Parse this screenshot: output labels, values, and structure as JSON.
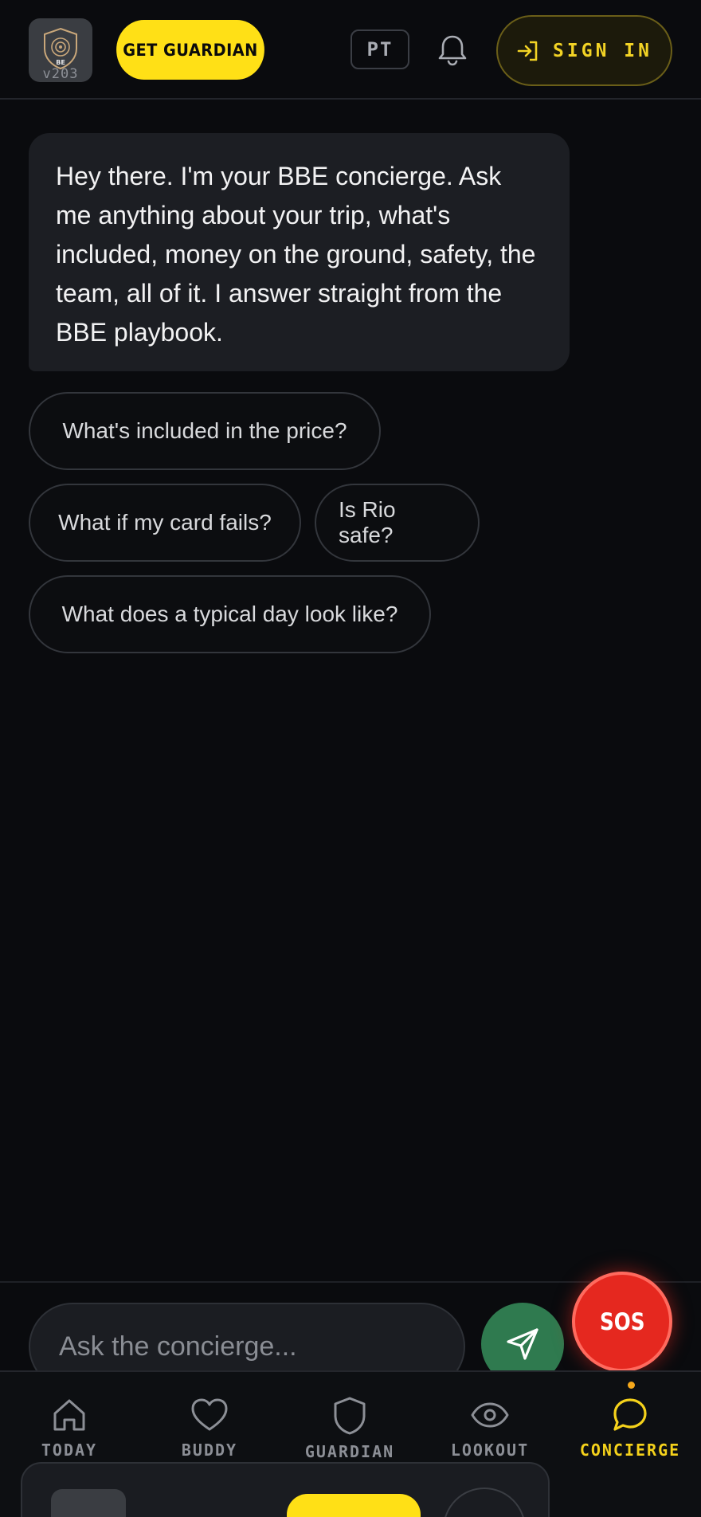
{
  "header": {
    "version": "v203",
    "logo_text": "BE",
    "get_guardian_label": "GET GUARDIAN",
    "language": "PT",
    "sign_in_label": "SIGN IN"
  },
  "chat": {
    "greeting": "Hey there. I'm your BBE concierge. Ask me anything about your trip, what's included, money on the ground, safety, the team, all of it. I answer straight from the BBE playbook.",
    "suggestions": [
      "What's included in the price?",
      "What if my card fails?",
      "Is Rio safe?",
      "What does a typical day look like?"
    ]
  },
  "composer": {
    "placeholder": "Ask the concierge...",
    "sos_label": "SOS"
  },
  "nav": {
    "items": [
      {
        "label": "TODAY",
        "icon": "home-icon"
      },
      {
        "label": "BUDDY",
        "icon": "heart-icon"
      },
      {
        "label": "GUARDIAN",
        "icon": "shield-icon"
      },
      {
        "label": "LOOKOUT",
        "icon": "eye-icon"
      },
      {
        "label": "CONCIERGE",
        "icon": "chat-bubble-icon",
        "active": true
      }
    ]
  },
  "colors": {
    "background": "#0a0b0e",
    "accent_yellow": "#ffe016",
    "sos_red": "#e5281f",
    "send_green": "#2f7a4f"
  }
}
